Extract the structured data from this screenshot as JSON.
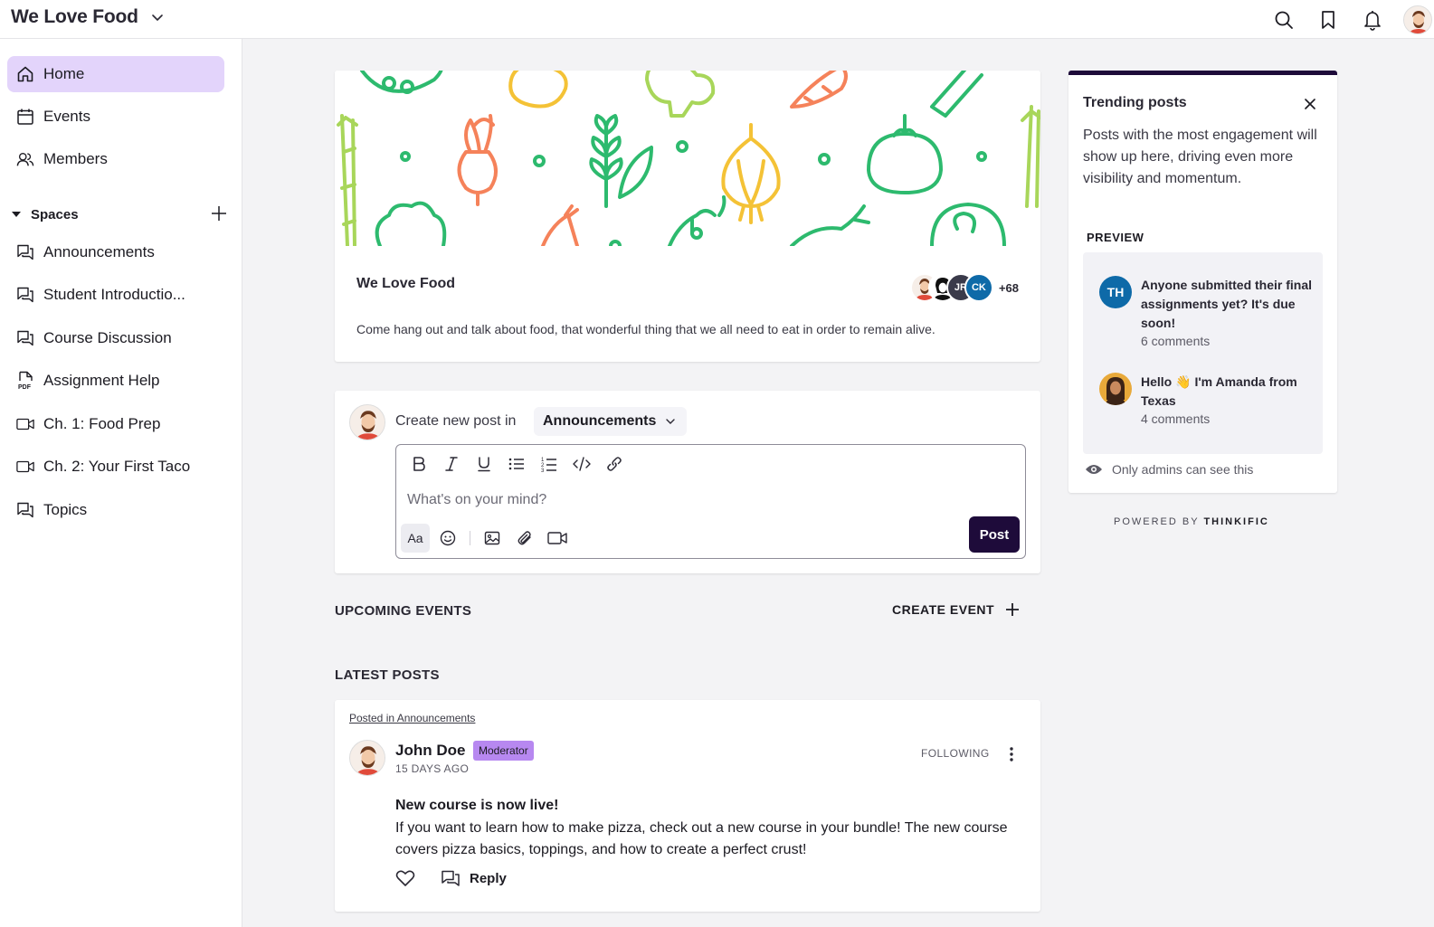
{
  "app": {
    "community_name": "We Love Food"
  },
  "sidebar": {
    "items": [
      {
        "label": "Home",
        "icon": "home-icon",
        "active": true
      },
      {
        "label": "Events",
        "icon": "calendar-icon"
      },
      {
        "label": "Members",
        "icon": "members-icon"
      }
    ],
    "spaces_heading": "Spaces",
    "spaces": [
      {
        "label": "Announcements",
        "icon": "discussion-icon"
      },
      {
        "label": "Student Introductio...",
        "icon": "discussion-icon"
      },
      {
        "label": "Course Discussion",
        "icon": "discussion-icon"
      },
      {
        "label": "Assignment Help",
        "icon": "pdf-icon"
      },
      {
        "label": "Ch. 1: Food Prep",
        "icon": "video-icon"
      },
      {
        "label": "Ch. 2: Your First Taco",
        "icon": "video-icon"
      },
      {
        "label": "Topics",
        "icon": "discussion-icon"
      }
    ]
  },
  "hero": {
    "title": "We Love Food",
    "description": "Come hang out and talk about food, that wonderful thing that we all need to eat in order to remain alive.",
    "member_initials": [
      "JR",
      "CK"
    ],
    "member_more": "+68"
  },
  "composer": {
    "label": "Create new post in",
    "space": "Announcements",
    "placeholder": "What's on your mind?",
    "format_toggle": "Aa",
    "post_button": "Post"
  },
  "events": {
    "heading": "UPCOMING EVENTS",
    "create_label": "CREATE EVENT"
  },
  "latest": {
    "heading": "LATEST POSTS",
    "post": {
      "posted_in": "Posted in Announcements",
      "author": "John Doe",
      "role": "Moderator",
      "time": "15 DAYS AGO",
      "follow_status": "FOLLOWING",
      "title": "New course is now live!",
      "body": "If you want to learn how to make pizza, check out a new course in your bundle! The new course covers pizza basics, toppings, and how to create a perfect crust!",
      "reply_label": "Reply"
    }
  },
  "trending": {
    "title": "Trending posts",
    "description": "Posts with the most engagement will show up here, driving even more visibility and momentum.",
    "preview_label": "PREVIEW",
    "posts": [
      {
        "initials": "TH",
        "title": "Anyone submitted their final assignments yet? It's due soon!",
        "comments": "6 comments",
        "color": "#0e6aa8"
      },
      {
        "initials": "",
        "title": "Hello 👋 I'm Amanda from Texas",
        "comments": "4 comments",
        "color": "#e8a93a"
      }
    ],
    "admin_note": "Only admins can see this"
  },
  "footer": {
    "powered_prefix": "POWERED BY",
    "powered_brand": "THINKIFIC"
  },
  "colors": {
    "accent": "#1e0b3a",
    "active_nav": "#e3d4fb",
    "moderator_badge": "#b788f0",
    "veg_green": "#2dba6e",
    "veg_orange": "#f5825a",
    "veg_yellow": "#f4c236",
    "veg_lime": "#a8d65a"
  }
}
